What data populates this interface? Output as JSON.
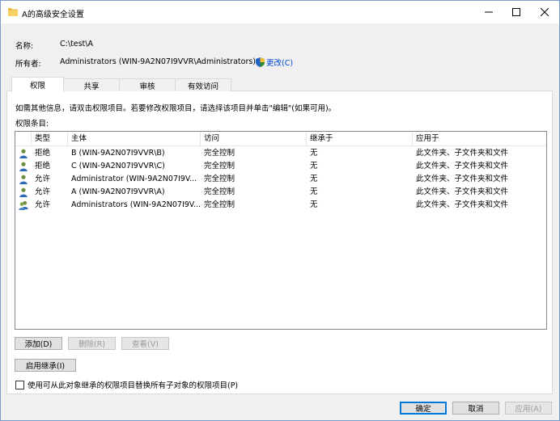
{
  "window": {
    "title": "A的高级安全设置"
  },
  "info": {
    "name_label": "名称:",
    "name_value": "C:\\test\\A",
    "owner_label": "所有者:",
    "owner_value": "Administrators (WIN-9A2N07I9VVR\\Administrators)",
    "change_link": "更改(C)"
  },
  "tabs": [
    {
      "label": "权限",
      "active": true
    },
    {
      "label": "共享",
      "active": false
    },
    {
      "label": "审核",
      "active": false
    },
    {
      "label": "有效访问",
      "active": false
    }
  ],
  "hint_text": "如需其他信息，请双击权限项目。若要修改权限项目，请选择该项目并单击\"编辑\"(如果可用)。",
  "perm_entries_label": "权限条目:",
  "columns": {
    "type": "类型",
    "principal": "主体",
    "access": "访问",
    "inherited_from": "继承于",
    "applies_to": "应用于"
  },
  "rows": [
    {
      "type": "拒绝",
      "principal": "B (WIN-9A2N07I9VVR\\B)",
      "access": "完全控制",
      "inherited_from": "无",
      "applies_to": "此文件夹、子文件夹和文件",
      "icon": "user-icon"
    },
    {
      "type": "拒绝",
      "principal": "C (WIN-9A2N07I9VVR\\C)",
      "access": "完全控制",
      "inherited_from": "无",
      "applies_to": "此文件夹、子文件夹和文件",
      "icon": "user-icon"
    },
    {
      "type": "允许",
      "principal": "Administrator (WIN-9A2N07I9V...",
      "access": "完全控制",
      "inherited_from": "无",
      "applies_to": "此文件夹、子文件夹和文件",
      "icon": "user-icon"
    },
    {
      "type": "允许",
      "principal": "A (WIN-9A2N07I9VVR\\A)",
      "access": "完全控制",
      "inherited_from": "无",
      "applies_to": "此文件夹、子文件夹和文件",
      "icon": "user-icon"
    },
    {
      "type": "允许",
      "principal": "Administrators (WIN-9A2N07I9V...",
      "access": "完全控制",
      "inherited_from": "无",
      "applies_to": "此文件夹、子文件夹和文件",
      "icon": "group-icon"
    }
  ],
  "buttons": {
    "add": "添加(D)",
    "remove": "删除(R)",
    "view": "查看(V)",
    "enable_inheritance": "启用继承(I)",
    "ok": "确定",
    "cancel": "取消",
    "apply": "应用(A)"
  },
  "replace_checkbox_label": "使用可从此对象继承的权限项目替换所有子对象的权限项目(P)",
  "colors": {
    "accent": "#0078d7",
    "link": "#0046d5",
    "folder": "#e8b83c"
  }
}
